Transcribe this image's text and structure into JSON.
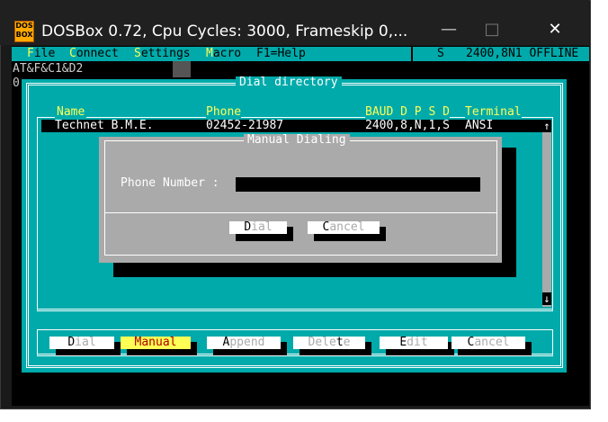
{
  "window": {
    "title": "DOSBox 0.72, Cpu Cycles:     3000, Frameskip  0,...",
    "minimize": "—",
    "maximize": "□",
    "close": "✕",
    "icon_text_top": "DOS",
    "icon_text_bottom": "BOX"
  },
  "menubar": {
    "items": [
      {
        "hot": "F",
        "rest": "ile"
      },
      {
        "hot": "C",
        "rest": "onnect"
      },
      {
        "hot": "S",
        "rest": "ettings"
      },
      {
        "hot": "M",
        "rest": "acro"
      }
    ],
    "help": "F1=Help",
    "status_s": "S",
    "status_line": "2400,8N1 OFFLINE"
  },
  "terminal": {
    "line1": "AT&F&C1&D2",
    "line2": "0"
  },
  "dial_directory": {
    "title": "Dial directory",
    "columns": {
      "name": "Name",
      "phone": "Phone",
      "baud": "BAUD D P S D",
      "terminal": "Terminal"
    },
    "row": {
      "name": "Technet B.M.E.",
      "phone": "02452-21987",
      "settings": "2400,8,N,1,S",
      "terminal": "ANSI"
    },
    "scroll_up": "↑",
    "scroll_down": "↓"
  },
  "manual_dialing": {
    "title": "Manual Dialing",
    "phone_label": "Phone Number :",
    "phone_value": "",
    "dial": {
      "hot": "D",
      "rest": "ial"
    },
    "cancel": {
      "hot": "C",
      "rest": "ancel"
    }
  },
  "buttons": [
    {
      "pre": "",
      "hot": "D",
      "rest": "ial",
      "selected": false
    },
    {
      "pre": "",
      "hot": "M",
      "rest": "anual",
      "selected": true
    },
    {
      "pre": "",
      "hot": "A",
      "rest": "ppend",
      "selected": false
    },
    {
      "pre": "Dele",
      "hot": "t",
      "rest": "e",
      "selected": false
    },
    {
      "pre": "",
      "hot": "E",
      "rest": "dit",
      "selected": false
    },
    {
      "pre": "",
      "hot": "C",
      "rest": "ancel",
      "selected": false
    }
  ]
}
